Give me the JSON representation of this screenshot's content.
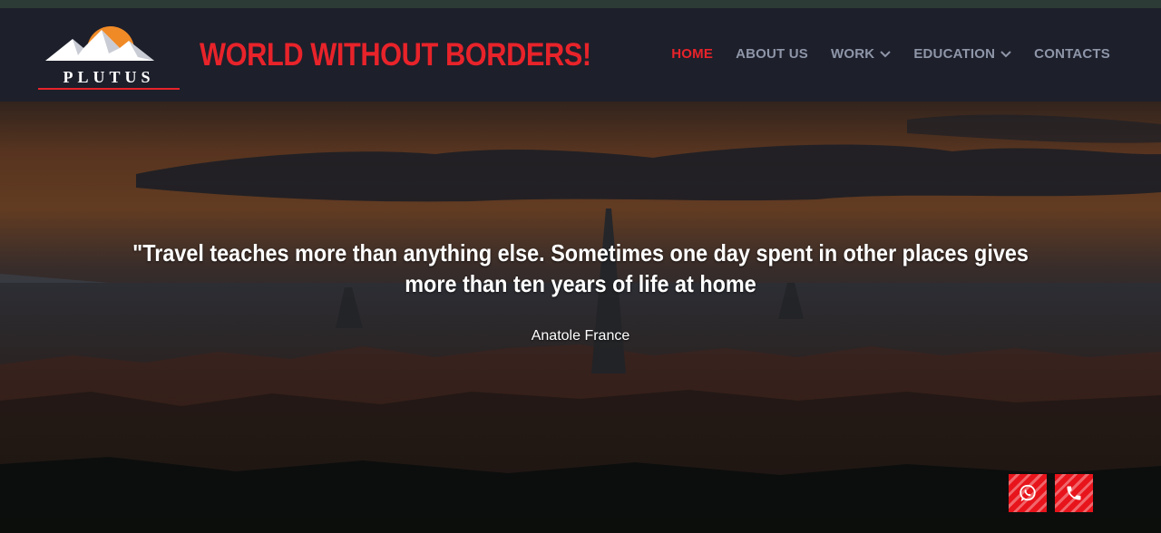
{
  "header": {
    "logo_text": "PLUTUS",
    "site_title": "WORLD WITHOUT BORDERS!"
  },
  "nav": {
    "items": [
      {
        "label": "HOME",
        "active": true,
        "dropdown": false
      },
      {
        "label": "ABOUT US",
        "active": false,
        "dropdown": false
      },
      {
        "label": "WORK",
        "active": false,
        "dropdown": true
      },
      {
        "label": "EDUCATION",
        "active": false,
        "dropdown": true
      },
      {
        "label": "CONTACTS",
        "active": false,
        "dropdown": false
      }
    ]
  },
  "hero": {
    "quote": "\"Travel teaches more than anything else. Sometimes one day spent in other places gives more than ten years of life at home",
    "author": "Anatole France"
  },
  "floating_buttons": {
    "whatsapp_icon": "whatsapp-icon",
    "phone_icon": "phone-icon"
  },
  "colors": {
    "accent": "#e8232a",
    "header_bg": "#1d1f2b",
    "nav_text": "#8e96a8",
    "fab_bg": "#e8141c"
  }
}
